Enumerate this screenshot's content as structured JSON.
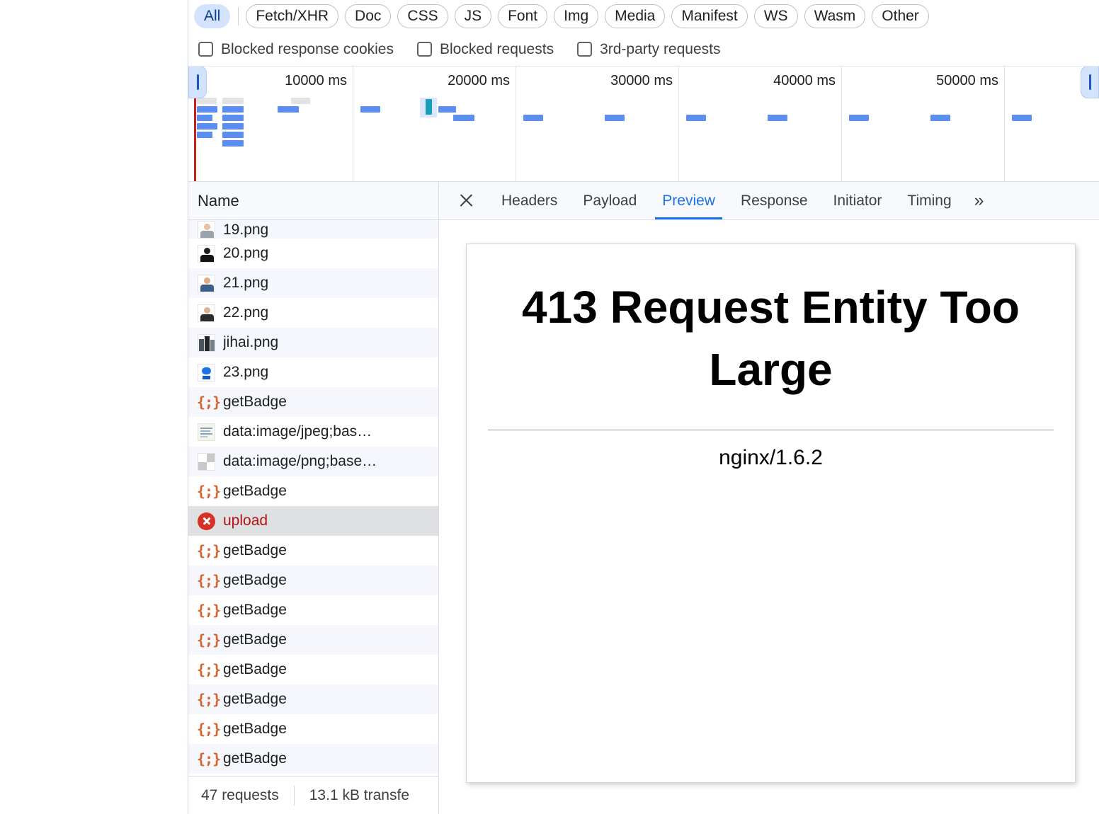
{
  "filters": {
    "types": [
      {
        "label": "All",
        "active": true
      },
      {
        "label": "Fetch/XHR",
        "active": false
      },
      {
        "label": "Doc",
        "active": false
      },
      {
        "label": "CSS",
        "active": false
      },
      {
        "label": "JS",
        "active": false
      },
      {
        "label": "Font",
        "active": false
      },
      {
        "label": "Img",
        "active": false
      },
      {
        "label": "Media",
        "active": false
      },
      {
        "label": "Manifest",
        "active": false
      },
      {
        "label": "WS",
        "active": false
      },
      {
        "label": "Wasm",
        "active": false
      },
      {
        "label": "Other",
        "active": false
      }
    ],
    "checkboxes": [
      {
        "label": "Blocked response cookies",
        "checked": false
      },
      {
        "label": "Blocked requests",
        "checked": false
      },
      {
        "label": "3rd-party requests",
        "checked": false
      }
    ]
  },
  "overview": {
    "tick_labels": [
      "10000 ms",
      "20000 ms",
      "30000 ms",
      "40000 ms",
      "50000 ms"
    ],
    "marker_color": "#c5211c",
    "bar_color": "#5b8ef0",
    "selection_color": "#d2e3fb"
  },
  "request_list": {
    "column_header": "Name",
    "rows": [
      {
        "name": "19.png",
        "icon": "image-thumbnail-icon",
        "state": "clipped"
      },
      {
        "name": "20.png",
        "icon": "image-thumbnail-icon",
        "state": "normal"
      },
      {
        "name": "21.png",
        "icon": "image-thumbnail-icon",
        "state": "normal"
      },
      {
        "name": "22.png",
        "icon": "image-thumbnail-icon",
        "state": "normal"
      },
      {
        "name": "jihai.png",
        "icon": "image-thumbnail-icon",
        "state": "normal"
      },
      {
        "name": "23.png",
        "icon": "image-thumbnail-icon",
        "state": "normal"
      },
      {
        "name": "getBadge",
        "icon": "json-icon",
        "state": "normal"
      },
      {
        "name": "data:image/jpeg;bas…",
        "icon": "image-thumbnail-icon",
        "state": "normal"
      },
      {
        "name": "data:image/png;base…",
        "icon": "image-thumbnail-icon",
        "state": "normal"
      },
      {
        "name": "getBadge",
        "icon": "json-icon",
        "state": "normal"
      },
      {
        "name": "upload",
        "icon": "error-icon",
        "state": "selected"
      },
      {
        "name": "getBadge",
        "icon": "json-icon",
        "state": "normal"
      },
      {
        "name": "getBadge",
        "icon": "json-icon",
        "state": "normal"
      },
      {
        "name": "getBadge",
        "icon": "json-icon",
        "state": "normal"
      },
      {
        "name": "getBadge",
        "icon": "json-icon",
        "state": "normal"
      },
      {
        "name": "getBadge",
        "icon": "json-icon",
        "state": "normal"
      },
      {
        "name": "getBadge",
        "icon": "json-icon",
        "state": "normal"
      },
      {
        "name": "getBadge",
        "icon": "json-icon",
        "state": "normal"
      },
      {
        "name": "getBadge",
        "icon": "json-icon",
        "state": "normal"
      }
    ]
  },
  "status_bar": {
    "requests": "47 requests",
    "transferred": "13.1 kB transfe"
  },
  "details": {
    "close_label": "Close",
    "tabs": [
      {
        "label": "Headers",
        "active": false
      },
      {
        "label": "Payload",
        "active": false
      },
      {
        "label": "Preview",
        "active": true
      },
      {
        "label": "Response",
        "active": false
      },
      {
        "label": "Initiator",
        "active": false
      },
      {
        "label": "Timing",
        "active": false
      }
    ],
    "overflow_label": "»",
    "preview": {
      "title": "413 Request Entity Too Large",
      "server": "nginx/1.6.2"
    }
  },
  "colors": {
    "accent": "#1a73e8",
    "error": "#d93025",
    "error_text": "#b31412",
    "json_icon": "#d9602b",
    "stripe": "#f5f7fc",
    "selected_row": "#dfe0e1"
  }
}
